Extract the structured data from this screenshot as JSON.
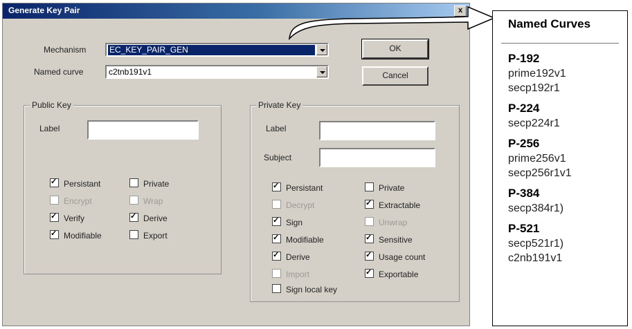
{
  "dialog": {
    "title": "Generate Key Pair",
    "close": "x",
    "mechanism_label": "Mechanism",
    "mechanism_value": "EC_KEY_PAIR_GEN",
    "named_curve_label": "Named curve",
    "named_curve_value": "c2tnb191v1",
    "ok": "OK",
    "cancel": "Cancel",
    "public": {
      "title": "Public Key",
      "label_field": "Label",
      "checkboxes": [
        {
          "label": "Persistant",
          "checked": true,
          "disabled": false
        },
        {
          "label": "Encrypt",
          "checked": false,
          "disabled": true
        },
        {
          "label": "Verify",
          "checked": true,
          "disabled": false
        },
        {
          "label": "Modifiable",
          "checked": true,
          "disabled": false
        },
        {
          "label": "Private",
          "checked": false,
          "disabled": false
        },
        {
          "label": "Wrap",
          "checked": false,
          "disabled": true
        },
        {
          "label": "Derive",
          "checked": true,
          "disabled": false
        },
        {
          "label": "Export",
          "checked": false,
          "disabled": false
        }
      ]
    },
    "private": {
      "title": "Private Key",
      "label_field": "Label",
      "subject_field": "Subject",
      "checkboxes": [
        {
          "label": "Persistant",
          "checked": true,
          "disabled": false
        },
        {
          "label": "Decrypt",
          "checked": false,
          "disabled": true
        },
        {
          "label": "Sign",
          "checked": true,
          "disabled": false
        },
        {
          "label": "Modifiable",
          "checked": true,
          "disabled": false
        },
        {
          "label": "Derive",
          "checked": true,
          "disabled": false
        },
        {
          "label": "Import",
          "checked": false,
          "disabled": true
        },
        {
          "label": "Sign local key",
          "checked": false,
          "disabled": false
        },
        {
          "label": "Private",
          "checked": false,
          "disabled": false
        },
        {
          "label": "Extractable",
          "checked": true,
          "disabled": false
        },
        {
          "label": "Unwrap",
          "checked": false,
          "disabled": true
        },
        {
          "label": "Sensitive",
          "checked": true,
          "disabled": false
        },
        {
          "label": "Usage count",
          "checked": true,
          "disabled": false
        },
        {
          "label": "Exportable",
          "checked": true,
          "disabled": false
        }
      ]
    }
  },
  "named_curves": {
    "title": "Named Curves",
    "groups": [
      {
        "name": "P-192",
        "aliases": [
          "prime192v1",
          "secp192r1"
        ]
      },
      {
        "name": "P-224",
        "aliases": [
          "secp224r1"
        ]
      },
      {
        "name": "P-256",
        "aliases": [
          "prime256v1",
          "secp256r1v1"
        ]
      },
      {
        "name": "P-384",
        "aliases": [
          "secp384r1)"
        ]
      },
      {
        "name": "P-521",
        "aliases": [
          "secp521r1)",
          "c2nb191v1"
        ]
      }
    ]
  },
  "colors": {
    "dialog_bg": "#d4d0c8",
    "title_bar": "#0a246a",
    "selection": "#0a246a"
  }
}
